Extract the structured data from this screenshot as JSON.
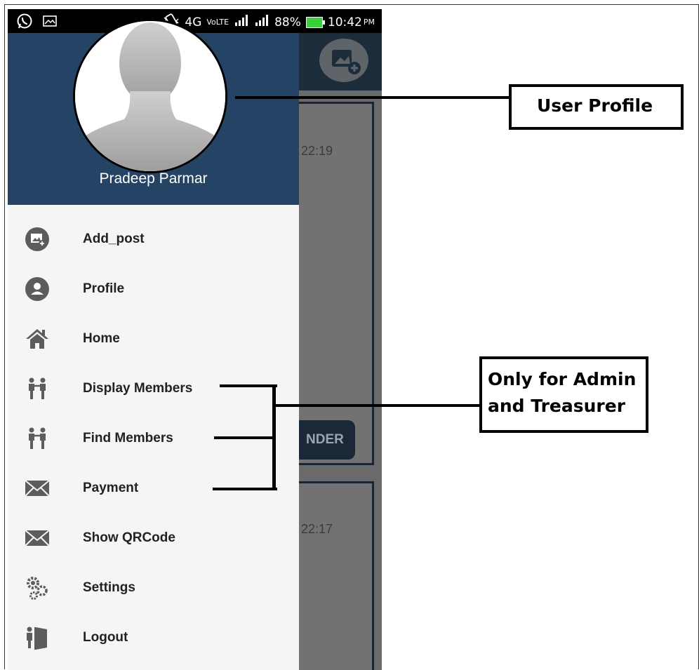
{
  "status_bar": {
    "network": "4G",
    "volte": "VoLTE",
    "battery": "88%",
    "time": "10:42",
    "ampm": "PM"
  },
  "background": {
    "times": [
      "22:19",
      "22:17"
    ],
    "button_fragment": "NDER"
  },
  "drawer": {
    "user_name": "Pradeep Parmar",
    "menu": [
      {
        "label": "Add_post",
        "icon": "add-image-icon"
      },
      {
        "label": "Profile",
        "icon": "user-circle-icon"
      },
      {
        "label": "Home",
        "icon": "home-icon"
      },
      {
        "label": "Display Members",
        "icon": "people-icon"
      },
      {
        "label": "Find Members",
        "icon": "people-icon"
      },
      {
        "label": "Payment",
        "icon": "envelope-icon"
      },
      {
        "label": "Show QRCode",
        "icon": "envelope-icon"
      },
      {
        "label": "Settings",
        "icon": "gears-icon"
      },
      {
        "label": "Logout",
        "icon": "exit-door-icon"
      }
    ]
  },
  "annotations": {
    "user_profile": "User Profile",
    "admin_line1": "Only for Admin",
    "admin_line2": "and Treasurer"
  }
}
